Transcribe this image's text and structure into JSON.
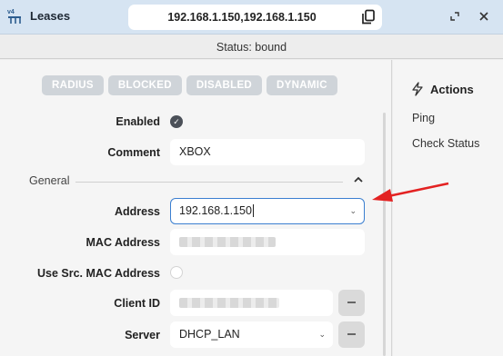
{
  "window": {
    "title": "Leases",
    "address_value": "192.168.1.150,192.168.1.150"
  },
  "status": "Status: bound",
  "flags": [
    "RADIUS",
    "BLOCKED",
    "DISABLED",
    "DYNAMIC"
  ],
  "form": {
    "enabled_label": "Enabled",
    "comment_label": "Comment",
    "comment_value": "XBOX",
    "section_general": "General",
    "address_label": "Address",
    "address_value": "192.168.1.150",
    "mac_label": "MAC Address",
    "use_src_mac_label": "Use Src. MAC Address",
    "client_id_label": "Client ID",
    "server_label": "Server",
    "server_value": "DHCP_LAN"
  },
  "side": {
    "title": "Actions",
    "items": [
      "Ping",
      "Check Status"
    ]
  },
  "colors": {
    "titlebar": "#d6e4f2",
    "focus": "#3b7fd0",
    "annotation_arrow": "#e32222",
    "flag": "#cfd4d9"
  }
}
